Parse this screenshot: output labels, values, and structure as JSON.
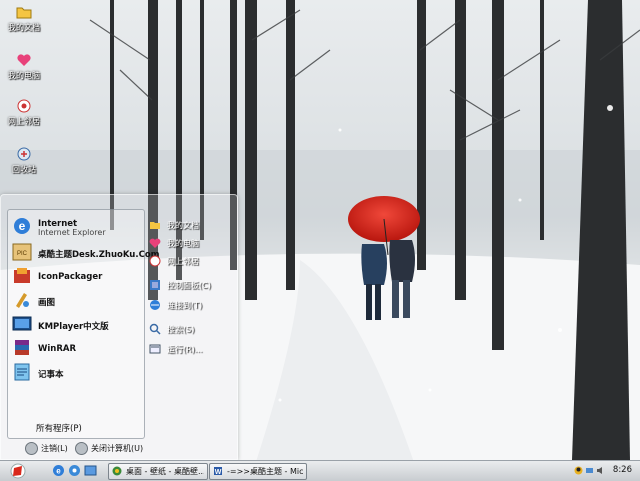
{
  "desktop": {
    "icons": [
      {
        "label": "我的文档",
        "icon": "folder-icon"
      },
      {
        "label": "我的电脑",
        "icon": "computer-icon"
      },
      {
        "label": "网上邻居",
        "icon": "network-icon"
      },
      {
        "label": "回收站",
        "icon": "recycle-bin-icon"
      }
    ]
  },
  "start_menu": {
    "programs": [
      {
        "title": "Internet",
        "subtitle": "Internet Explorer",
        "icon": "internet-explorer-icon"
      },
      {
        "title": "桌酷主题Desk.ZhuoKu.Com",
        "icon": "zhuoku-icon"
      },
      {
        "title": "IconPackager",
        "icon": "iconpackager-icon"
      },
      {
        "title": "画图",
        "icon": "paint-icon"
      },
      {
        "title": "KMPlayer中文版",
        "icon": "kmplayer-icon"
      },
      {
        "title": "WinRAR",
        "icon": "winrar-icon"
      },
      {
        "title": "记事本",
        "icon": "notepad-icon"
      }
    ],
    "all_programs": "所有程序(P)",
    "places": [
      {
        "label": "我的文档",
        "icon": "documents-icon"
      },
      {
        "label": "我的电脑",
        "icon": "computer-icon"
      },
      {
        "label": "网上邻居",
        "icon": "network-icon"
      },
      {
        "label": "控制面板(C)",
        "icon": "control-panel-icon"
      },
      {
        "label": "连接到(T)",
        "icon": "connect-icon"
      },
      {
        "label": "搜索(S)",
        "icon": "search-icon"
      },
      {
        "label": "运行(R)...",
        "icon": "run-icon"
      }
    ],
    "footer": {
      "logoff": "注销(L)",
      "shutdown": "关闭计算机(U)"
    }
  },
  "taskbar": {
    "tasks": [
      {
        "label": "桌面 - 壁纸 - 桌酷壁...",
        "icon": "browser-icon"
      },
      {
        "label": "-=>>桌酷主题 - Mic...",
        "icon": "document-icon"
      }
    ],
    "clock": "8:26",
    "colors": {
      "accent": "#d9291c",
      "taskbar": "#d4d7da"
    }
  }
}
